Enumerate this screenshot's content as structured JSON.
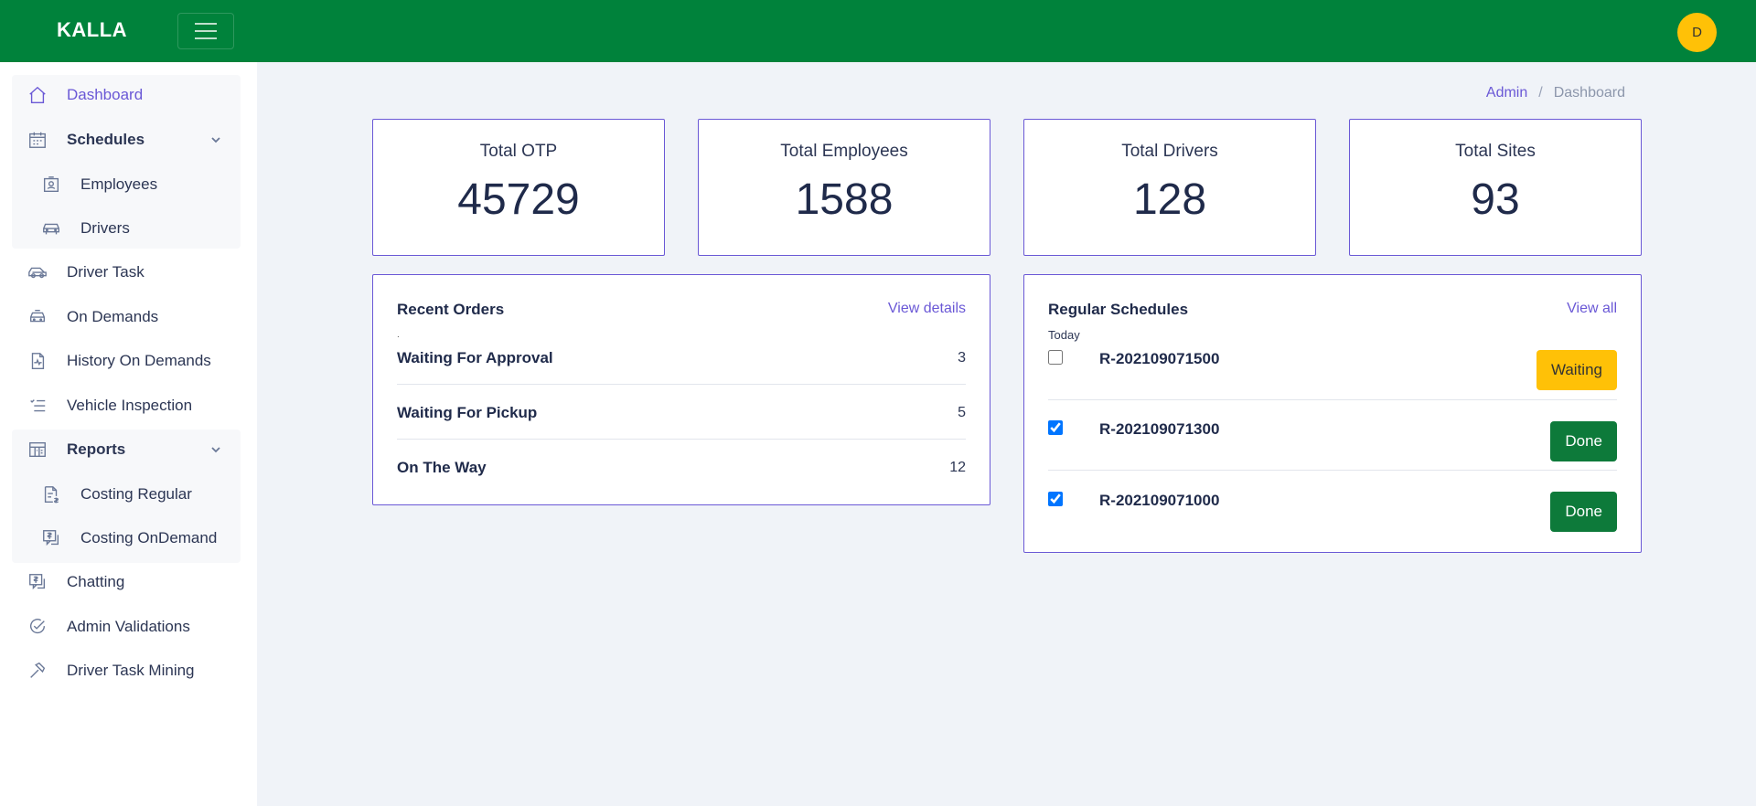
{
  "header": {
    "brand": "KALLA",
    "avatar_initial": "D",
    "colors": {
      "bar": "#00823b",
      "avatar": "#ffc107",
      "accent": "#6a58d6"
    }
  },
  "sidebar": {
    "dashboard": "Dashboard",
    "schedules": "Schedules",
    "employees": "Employees",
    "drivers": "Drivers",
    "driver_task": "Driver Task",
    "on_demands": "On Demands",
    "history_on_demands": "History On Demands",
    "vehicle_inspection": "Vehicle Inspection",
    "reports": "Reports",
    "costing_regular": "Costing Regular",
    "costing_ondemand": "Costing OnDemand",
    "chatting": "Chatting",
    "admin_validations": "Admin Validations",
    "driver_task_mining": "Driver Task Mining"
  },
  "breadcrumb": {
    "root": "Admin",
    "separator": "/",
    "current": "Dashboard"
  },
  "stats": [
    {
      "label": "Total OTP",
      "value": "45729"
    },
    {
      "label": "Total Employees",
      "value": "1588"
    },
    {
      "label": "Total Drivers",
      "value": "128"
    },
    {
      "label": "Total Sites",
      "value": "93"
    }
  ],
  "recent_orders": {
    "title": "Recent Orders",
    "link": "View details",
    "dot": ".",
    "rows": [
      {
        "name": "Waiting For Approval",
        "count": "3"
      },
      {
        "name": "Waiting For Pickup",
        "count": "5"
      },
      {
        "name": "On The Way",
        "count": "12"
      }
    ]
  },
  "regular_schedules": {
    "title": "Regular Schedules",
    "link": "View all",
    "today": "Today",
    "rows": [
      {
        "code": "R-202109071500",
        "checked": false,
        "status": "Waiting"
      },
      {
        "code": "R-202109071300",
        "checked": true,
        "status": "Done"
      },
      {
        "code": "R-202109071000",
        "checked": true,
        "status": "Done"
      }
    ]
  }
}
